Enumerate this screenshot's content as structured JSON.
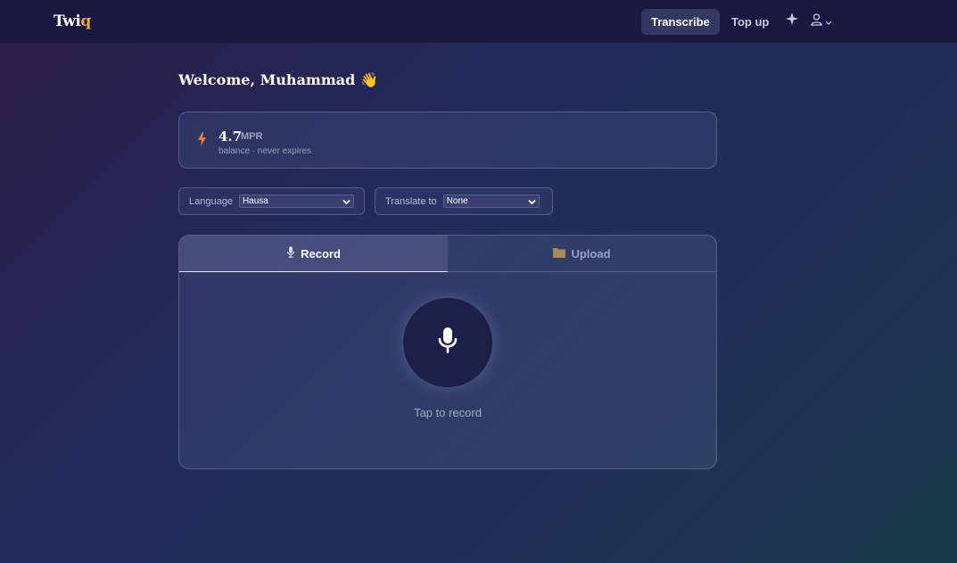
{
  "header": {
    "logo_main": "Twi",
    "logo_accent": "q",
    "nav": {
      "transcribe": "Transcribe",
      "topup": "Top up"
    },
    "icons": [
      "sparkle-icon",
      "user-icon",
      "chevron-down-icon"
    ]
  },
  "welcome": {
    "text": "Welcome, Muhammad",
    "emoji": "👋"
  },
  "balance": {
    "value": "4.7",
    "unit": "MPR",
    "subtitle": "balance · never expires",
    "icon": "bolt-icon",
    "icon_color": "#f07a3a"
  },
  "language": {
    "label": "Language",
    "selected": "Hausa"
  },
  "translate": {
    "label": "Translate to",
    "selected": "None"
  },
  "tabs": {
    "record": "Record",
    "upload": "Upload",
    "active": "record"
  },
  "recorder": {
    "hint": "Tap to record",
    "icon": "microphone-icon"
  },
  "colors": {
    "accent": "#f2a53a",
    "header_bg": "#181840",
    "mic_bg": "#1d1f48"
  }
}
